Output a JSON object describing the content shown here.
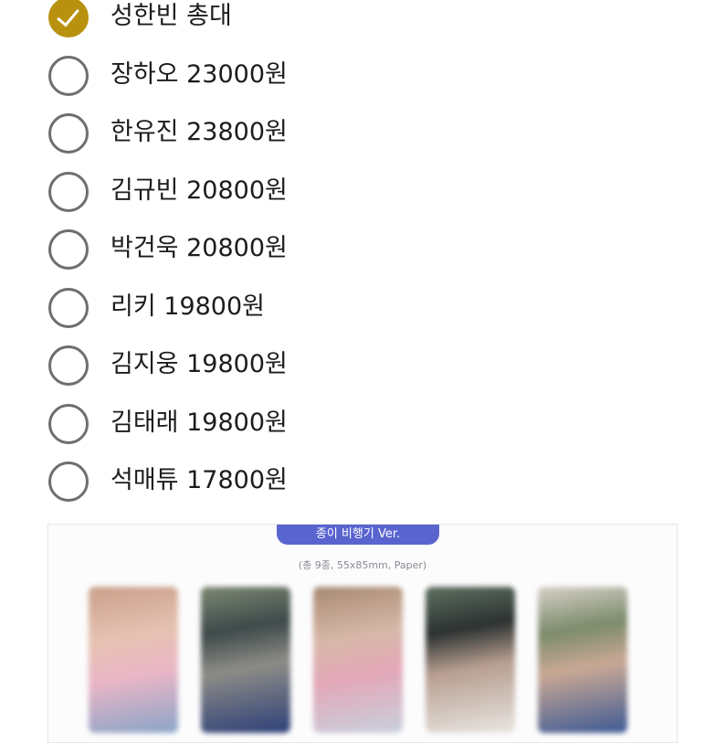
{
  "options": [
    {
      "label": "성한빈 총대",
      "selected": true
    },
    {
      "label": "장하오 23000원",
      "selected": false
    },
    {
      "label": "한유진 23800원",
      "selected": false
    },
    {
      "label": "김규빈 20800원",
      "selected": false
    },
    {
      "label": "박건욱 20800원",
      "selected": false
    },
    {
      "label": "리키 19800원",
      "selected": false
    },
    {
      "label": "김지웅 19800원",
      "selected": false
    },
    {
      "label": "김태래 19800원",
      "selected": false
    },
    {
      "label": "석매튜 17800원",
      "selected": false
    }
  ],
  "product": {
    "version_label": "종이 비행기 Ver.",
    "spec_text": "(총 9종, 55x85mm, Paper)"
  },
  "colors": {
    "accent": "#b8920f",
    "radio_border": "#6e6e6e",
    "pill": "#5a64cf"
  }
}
